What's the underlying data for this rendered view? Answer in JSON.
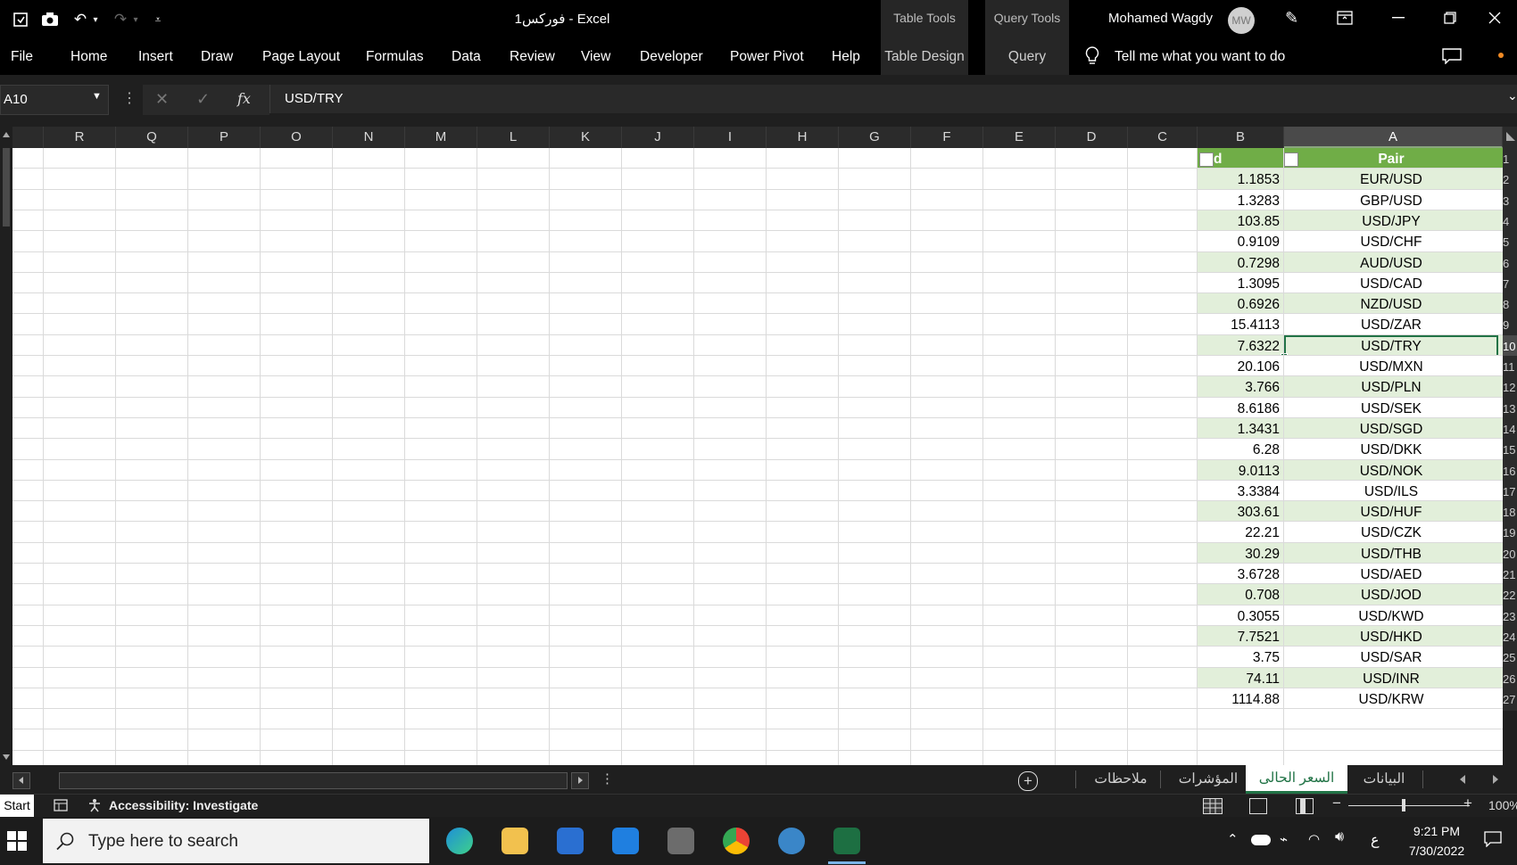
{
  "window": {
    "title": "فوركس1  -  Excel",
    "user_name": "Mohamed Wagdy",
    "user_initials": "MW"
  },
  "ribbon": {
    "tabs": [
      "File",
      "Home",
      "Insert",
      "Draw",
      "Page Layout",
      "Formulas",
      "Data",
      "Review",
      "View",
      "Developer",
      "Power Pivot",
      "Help"
    ],
    "context_groups": [
      {
        "header": "Table Tools",
        "tab": "Table Design"
      },
      {
        "header": "Query Tools",
        "tab": "Query"
      }
    ],
    "tell_me": "Tell me what you want to do"
  },
  "formula_bar": {
    "name_box": "A10",
    "fx_label": "fx",
    "content": "USD/TRY"
  },
  "columns": [
    "R",
    "Q",
    "P",
    "O",
    "N",
    "M",
    "L",
    "K",
    "J",
    "I",
    "H",
    "G",
    "F",
    "E",
    "D",
    "C",
    "B",
    "A"
  ],
  "table": {
    "header_a": "Pair",
    "header_b": "d",
    "rows": [
      {
        "n": "2",
        "pair": "EUR/USD",
        "val": "1.1853"
      },
      {
        "n": "3",
        "pair": "GBP/USD",
        "val": "1.3283"
      },
      {
        "n": "4",
        "pair": "USD/JPY",
        "val": "103.85"
      },
      {
        "n": "5",
        "pair": "USD/CHF",
        "val": "0.9109"
      },
      {
        "n": "6",
        "pair": "AUD/USD",
        "val": "0.7298"
      },
      {
        "n": "7",
        "pair": "USD/CAD",
        "val": "1.3095"
      },
      {
        "n": "8",
        "pair": "NZD/USD",
        "val": "0.6926"
      },
      {
        "n": "9",
        "pair": "USD/ZAR",
        "val": "15.4113"
      },
      {
        "n": "10",
        "pair": "USD/TRY",
        "val": "7.6322"
      },
      {
        "n": "11",
        "pair": "USD/MXN",
        "val": "20.106"
      },
      {
        "n": "12",
        "pair": "USD/PLN",
        "val": "3.766"
      },
      {
        "n": "13",
        "pair": "USD/SEK",
        "val": "8.6186"
      },
      {
        "n": "14",
        "pair": "USD/SGD",
        "val": "1.3431"
      },
      {
        "n": "15",
        "pair": "USD/DKK",
        "val": "6.28"
      },
      {
        "n": "16",
        "pair": "USD/NOK",
        "val": "9.0113"
      },
      {
        "n": "17",
        "pair": "USD/ILS",
        "val": "3.3384"
      },
      {
        "n": "18",
        "pair": "USD/HUF",
        "val": "303.61"
      },
      {
        "n": "19",
        "pair": "USD/CZK",
        "val": "22.21"
      },
      {
        "n": "20",
        "pair": "USD/THB",
        "val": "30.29"
      },
      {
        "n": "21",
        "pair": "USD/AED",
        "val": "3.6728"
      },
      {
        "n": "22",
        "pair": "USD/JOD",
        "val": "0.708"
      },
      {
        "n": "23",
        "pair": "USD/KWD",
        "val": "0.3055"
      },
      {
        "n": "24",
        "pair": "USD/HKD",
        "val": "7.7521"
      },
      {
        "n": "25",
        "pair": "USD/SAR",
        "val": "3.75"
      },
      {
        "n": "26",
        "pair": "USD/INR",
        "val": "74.11"
      },
      {
        "n": "27",
        "pair": "USD/KRW",
        "val": "1114.88"
      }
    ]
  },
  "sheet_tabs": [
    "ملاحظات",
    "المؤشرات",
    "السعر الحالى",
    "البيانات"
  ],
  "active_sheet": "السعر الحالى",
  "status": {
    "mode": "Start",
    "accessibility": "Accessibility: Investigate",
    "zoom": "100%"
  },
  "taskbar": {
    "search_placeholder": "Type here to search",
    "time": "9:21 PM",
    "date": "7/30/2022",
    "lang": "ع"
  },
  "colors": {
    "table_header": "#70ad47",
    "band_light": "#e2efda",
    "selection": "#217346"
  }
}
